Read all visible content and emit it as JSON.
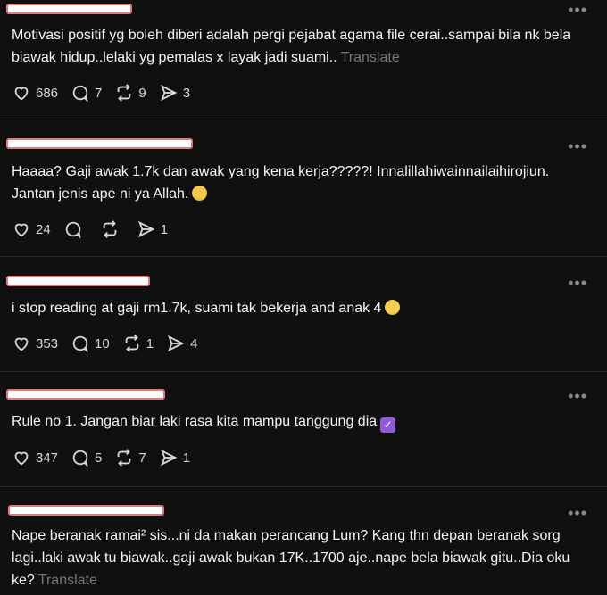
{
  "posts": [
    {
      "text": "Motivasi positif yg boleh diberi adalah pergi pejabat agama file cerai..sampai bila nk bela biawak hidup..lelaki yg pemalas x layak jadi suami..",
      "translate": "Translate",
      "likes": "686",
      "replies": "7",
      "reposts": "9",
      "shares": "3"
    },
    {
      "text": "Haaaa? Gaji awak 1.7k dan awak yang kena kerja?????! Innalillahiwainnailaihirojiun. Jantan jenis ape ni ya Allah.",
      "emoji": "face-screaming",
      "likes": "24",
      "replies": "",
      "reposts": "",
      "shares": "1"
    },
    {
      "text": "i stop reading at gaji rm1.7k, suami tak bekerja and anak 4",
      "emoji": "flushed-face",
      "likes": "353",
      "replies": "10",
      "reposts": "1",
      "shares": "4"
    },
    {
      "text": "Rule no 1. Jangan biar laki rasa kita mampu tanggung dia",
      "emoji": "check-mark-button",
      "likes": "347",
      "replies": "5",
      "reposts": "7",
      "shares": "1"
    },
    {
      "text": "Nape beranak ramai² sis...ni da makan perancang Lum? Kang thn depan beranak sorg lagi..laki awak tu biawak..gaji awak bukan 17K..1700 aje..nape bela biawak gitu..Dia oku ke?",
      "translate": "Translate"
    }
  ],
  "icons": {
    "like": "heart-icon",
    "reply": "comment-icon",
    "repost": "repost-icon",
    "share": "send-icon",
    "more": "more-icon"
  },
  "colors": {
    "background": "#101010",
    "text": "#f3f5f7",
    "muted": "#777777"
  }
}
